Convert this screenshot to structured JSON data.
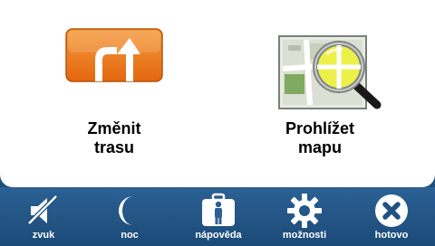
{
  "tiles": {
    "change_route": {
      "line1": "Změnit",
      "line2": "trasu",
      "icon": "route-change-icon"
    },
    "browse_map": {
      "line1": "Prohlížet",
      "line2": "mapu",
      "icon": "map-magnifier-icon"
    }
  },
  "toolbar": {
    "items": [
      {
        "label": "zvuk",
        "icon": "sound-muted-icon"
      },
      {
        "label": "noc",
        "icon": "moon-icon"
      },
      {
        "label": "nápověda",
        "icon": "help-kit-icon"
      },
      {
        "label": "možnosti",
        "icon": "gear-icon"
      },
      {
        "label": "hotovo",
        "icon": "close-icon"
      }
    ]
  },
  "colors": {
    "route_tile": "#f07b1d",
    "bar_background": "#1e4f7c",
    "main_background": "#ffffff"
  }
}
